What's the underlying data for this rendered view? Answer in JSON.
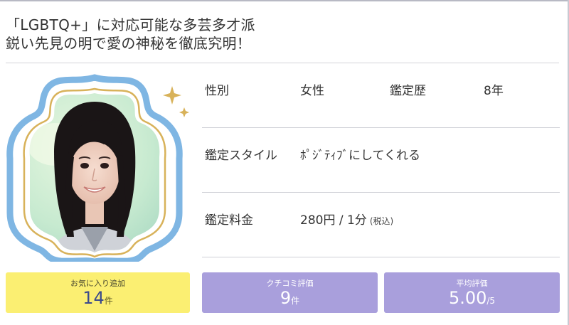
{
  "headline": {
    "line1": "「LGBTQ+」に対応可能な多芸多才派",
    "line2": "鋭い先見の明で愛の神秘を徹底究明！"
  },
  "profile": {
    "gender_label": "性別",
    "gender_value": "女性",
    "career_label": "鑑定歴",
    "career_value": "8年",
    "style_label": "鑑定スタイル",
    "style_value": "ﾎﾟｼﾞﾃｨﾌﾞにしてくれる",
    "fee_label": "鑑定料金",
    "fee_value": "280円 / 1分",
    "fee_tax": "(税込)"
  },
  "stats": {
    "favorites": {
      "label": "お気に入り追加",
      "value": "14",
      "unit": "件"
    },
    "reviews": {
      "label": "クチコミ評価",
      "value": "9",
      "unit": "件"
    },
    "rating": {
      "label": "平均評価",
      "value": "5.00",
      "unit": "/5"
    }
  },
  "colors": {
    "frame_blue": "#7fb6e3",
    "frame_gold": "#d8b25a",
    "favorite_bg": "#fbef72",
    "stat_bg": "#a99fdc"
  }
}
